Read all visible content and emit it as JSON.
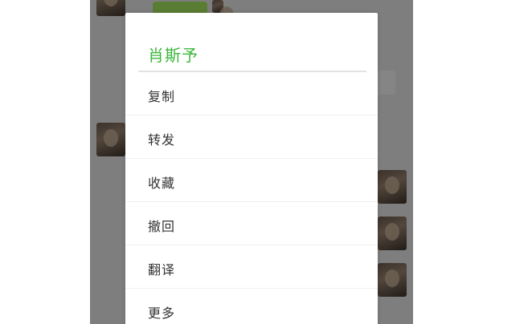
{
  "dialog": {
    "title": "肖斯予",
    "title_color": "#3cb73c",
    "menu": [
      {
        "label": "复制"
      },
      {
        "label": "转发"
      },
      {
        "label": "收藏"
      },
      {
        "label": "撤回"
      },
      {
        "label": "翻译"
      },
      {
        "label": "更多"
      }
    ]
  },
  "colors": {
    "scrim": "rgba(0,0,0,0.46)",
    "bubble_sent": "#a6e860"
  }
}
